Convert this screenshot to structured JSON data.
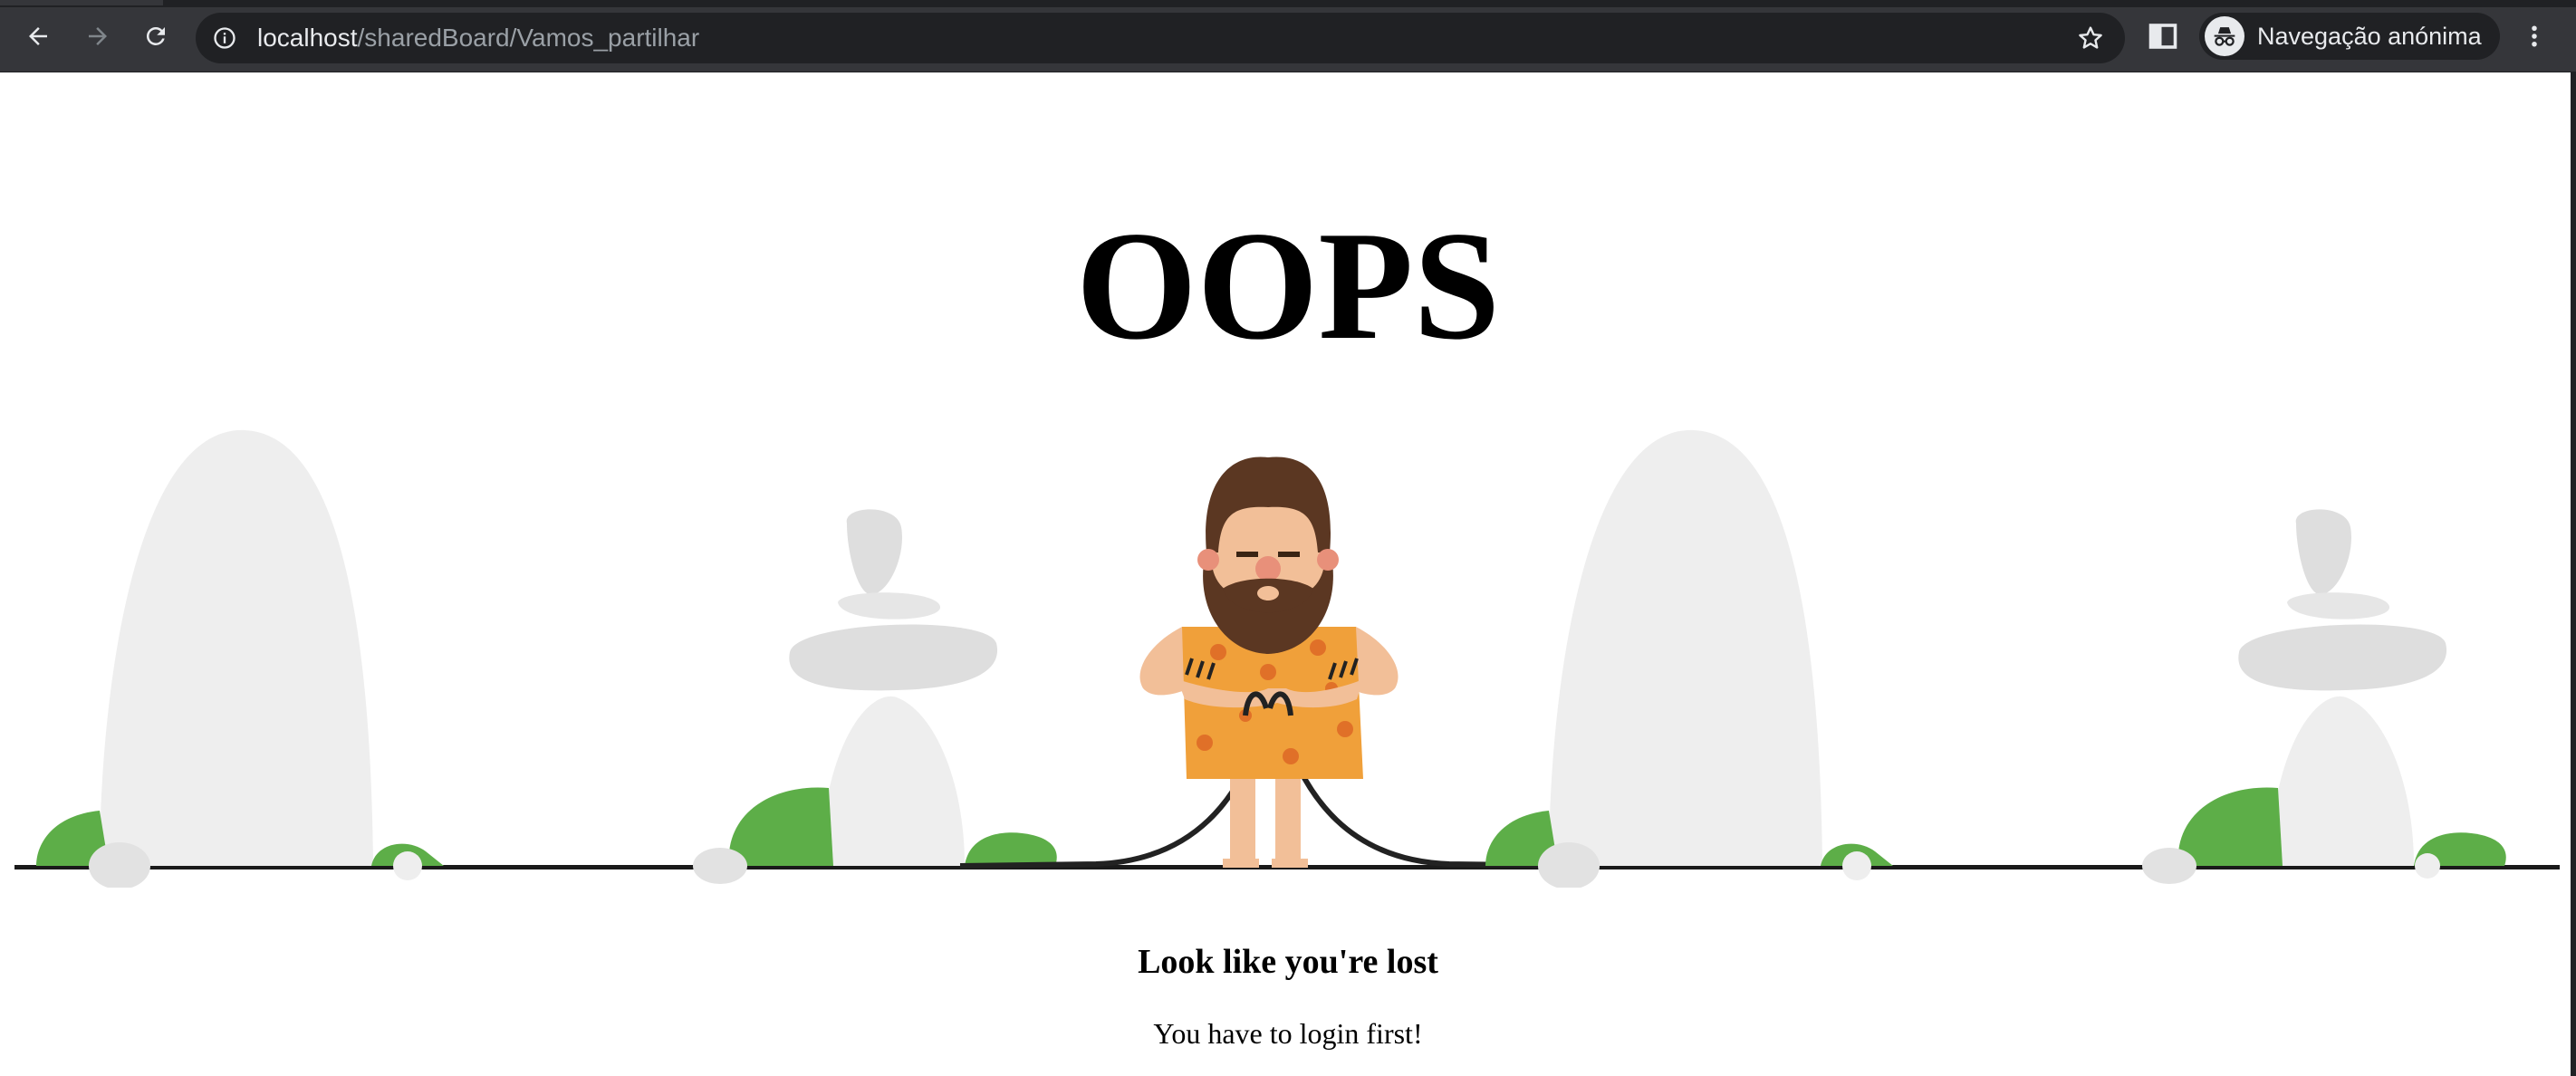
{
  "browser": {
    "url_host": "localhost",
    "url_path": "/sharedBoard/Vamos_partilhar",
    "profile_label": "Navegação anónima",
    "theme": {
      "toolbar_bg": "#35363a",
      "omnibox_bg": "#202124",
      "text": "#e8eaed",
      "muted_text": "#9aa0a6"
    },
    "icons": {
      "back": "arrow-left-icon",
      "forward": "arrow-right-icon",
      "reload": "reload-icon",
      "site_info": "info-icon",
      "bookmark": "star-icon",
      "side_panel": "side-panel-icon",
      "incognito": "incognito-icon",
      "menu": "kebab-menu-icon"
    }
  },
  "page": {
    "heading": "OOPS",
    "subheading": "Look like you're lost",
    "message": "You have to login first!",
    "colors": {
      "rock": "#eeeeee",
      "stone": "#dedede",
      "bush": "#5dae48",
      "ground": "#1a1a1a",
      "hair": "#5b3722",
      "skin": "#f2bf98",
      "tunic": "#f0a03a",
      "spots": "#e07028"
    }
  }
}
